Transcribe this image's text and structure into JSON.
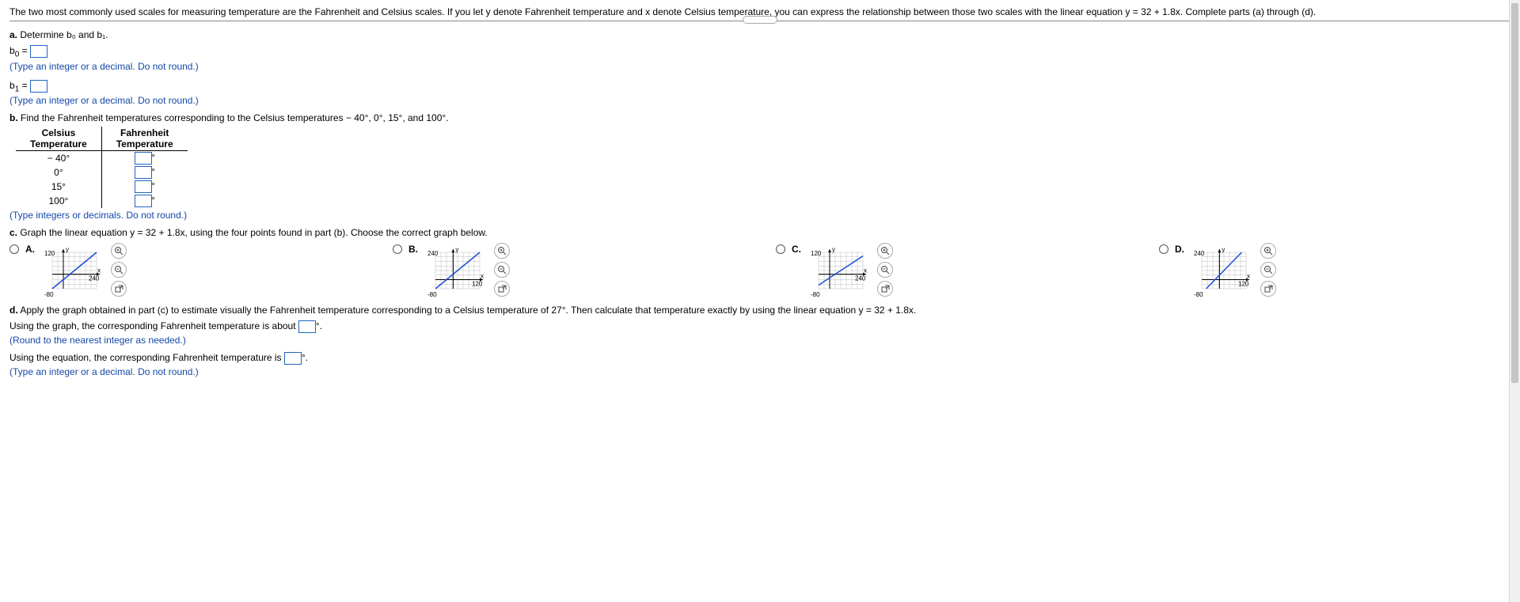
{
  "intro": "The two most commonly used scales for measuring temperature are the Fahrenheit and Celsius scales. If you let y denote Fahrenheit temperature and x denote Celsius temperature, you can express the relationship between those two scales with the linear equation y = 32 + 1.8x. Complete parts (a) through (d).",
  "a": {
    "prompt_prefix": "a.",
    "prompt": "Determine b₀ and b₁.",
    "b0_label": "b₀ =",
    "b1_label": "b₁ =",
    "hint": "(Type an integer or a decimal. Do not round.)"
  },
  "b": {
    "prompt_prefix": "b.",
    "prompt": "Find the Fahrenheit temperatures corresponding to the Celsius temperatures − 40°, 0°, 15°, and 100°.",
    "headers": {
      "c": "Celsius Temperature",
      "f": "Fahrenheit Temperature"
    },
    "rows": [
      {
        "c": "− 40°"
      },
      {
        "c": "0°"
      },
      {
        "c": "15°"
      },
      {
        "c": "100°"
      }
    ],
    "degree": "°",
    "hint": "(Type integers or decimals. Do not round.)"
  },
  "c": {
    "prompt_prefix": "c.",
    "prompt": "Graph the linear equation y = 32 + 1.8x, using the four points found in part (b). Choose the correct graph below.",
    "options": [
      {
        "label": "A.",
        "ymax": "120",
        "ymin": "-80",
        "xmin": "-80",
        "xmax": "240"
      },
      {
        "label": "B.",
        "ymax": "240",
        "ymin": "-80",
        "xmin": "-80",
        "xmax": "120"
      },
      {
        "label": "C.",
        "ymax": "120",
        "ymin": "-80",
        "xmin": "-80",
        "xmax": "240"
      },
      {
        "label": "D.",
        "ymax": "240",
        "ymin": "-80",
        "xmin": "-80",
        "xmax": "120"
      }
    ]
  },
  "d": {
    "prompt_prefix": "d.",
    "prompt": "Apply the graph obtained in part (c) to estimate visually the Fahrenheit temperature corresponding to a Celsius temperature of 27°. Then calculate that temperature exactly by using the linear equation y = 32 + 1.8x.",
    "line1_pre": "Using the graph, the corresponding Fahrenheit temperature is about",
    "line1_post": "°.",
    "hint1": "(Round to the nearest integer as needed.)",
    "line2_pre": "Using the equation, the corresponding Fahrenheit temperature is",
    "line2_post": "°.",
    "hint2": "(Type an integer or a decimal. Do not round.)"
  },
  "chart_data": [
    {
      "type": "line",
      "title": "Option A",
      "xlabel": "x",
      "ylabel": "y",
      "xlim": [
        -80,
        240
      ],
      "ylim": [
        -80,
        120
      ],
      "series": [
        {
          "name": "line",
          "points": [
            [
              -80,
              -80
            ],
            [
              240,
              120
            ]
          ]
        }
      ]
    },
    {
      "type": "line",
      "title": "Option B",
      "xlabel": "x",
      "ylabel": "y",
      "xlim": [
        -80,
        120
      ],
      "ylim": [
        -80,
        240
      ],
      "series": [
        {
          "name": "line",
          "points": [
            [
              -80,
              -80
            ],
            [
              120,
              240
            ]
          ]
        }
      ]
    },
    {
      "type": "line",
      "title": "Option C",
      "xlabel": "x",
      "ylabel": "y",
      "xlim": [
        -80,
        240
      ],
      "ylim": [
        -80,
        120
      ],
      "series": [
        {
          "name": "line",
          "points": [
            [
              -80,
              -60
            ],
            [
              240,
              100
            ]
          ]
        }
      ]
    },
    {
      "type": "line",
      "title": "Option D",
      "xlabel": "x",
      "ylabel": "y",
      "xlim": [
        -80,
        120
      ],
      "ylim": [
        -80,
        240
      ],
      "series": [
        {
          "name": "line",
          "points": [
            [
              -60,
              -80
            ],
            [
              100,
              240
            ]
          ]
        }
      ]
    }
  ]
}
